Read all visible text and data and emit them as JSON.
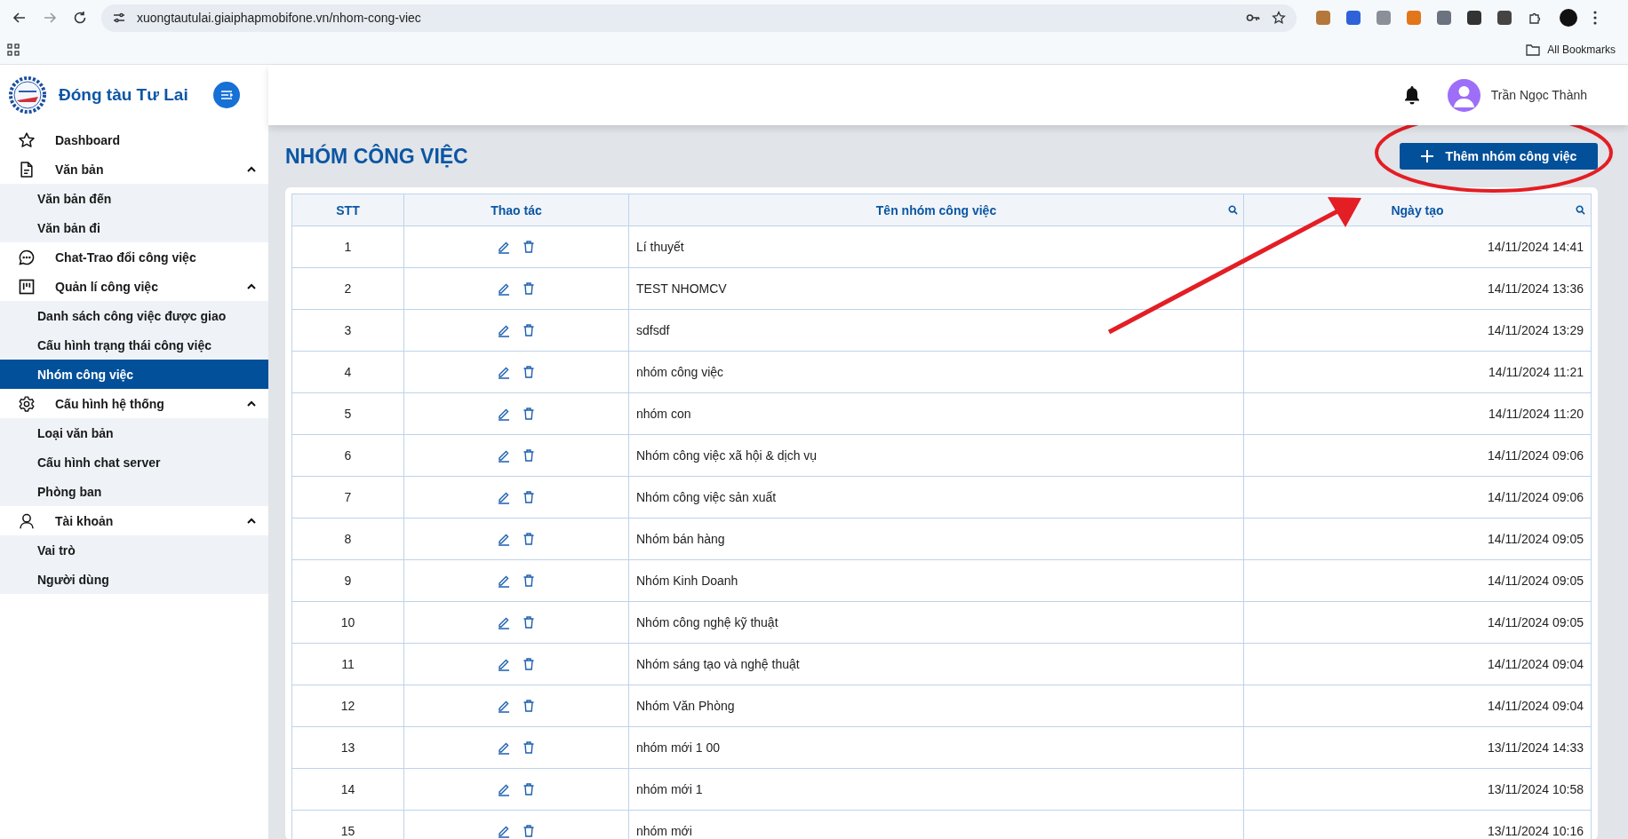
{
  "browser": {
    "url": "xuongtautulai.giaiphapmobifone.vn/nhom-cong-viec",
    "bookmarks_label": "All Bookmarks"
  },
  "app": {
    "name": "Đóng tàu Tư Lai"
  },
  "user": {
    "name": "Trần Ngọc Thành"
  },
  "sidebar": {
    "items": [
      {
        "label": "Dashboard",
        "selected": false
      },
      {
        "label": "Văn bản",
        "selected": false,
        "expanded": true,
        "children": [
          {
            "label": "Văn bản đến",
            "selected": false
          },
          {
            "label": "Văn bản đi",
            "selected": false
          }
        ]
      },
      {
        "label": "Chat-Trao đổi công việc",
        "selected": false
      },
      {
        "label": "Quản lí công việc",
        "selected": false,
        "expanded": true,
        "children": [
          {
            "label": "Danh sách công việc được giao",
            "selected": false
          },
          {
            "label": "Cấu hình trạng thái công việc",
            "selected": false
          },
          {
            "label": "Nhóm công việc",
            "selected": true
          }
        ]
      },
      {
        "label": "Cấu hình hệ thống",
        "selected": false,
        "expanded": true,
        "children": [
          {
            "label": "Loại văn bản",
            "selected": false
          },
          {
            "label": "Cấu hình chat server",
            "selected": false
          },
          {
            "label": "Phòng ban",
            "selected": false
          }
        ]
      },
      {
        "label": "Tài khoản",
        "selected": false,
        "expanded": true,
        "children": [
          {
            "label": "Vai trò",
            "selected": false
          },
          {
            "label": "Người dùng",
            "selected": false
          }
        ]
      }
    ]
  },
  "page": {
    "title": "NHÓM CÔNG VIỆC",
    "add_button": "Thêm nhóm công việc"
  },
  "table": {
    "columns": [
      {
        "label": "STT",
        "searchable": false
      },
      {
        "label": "Thao tác",
        "searchable": false
      },
      {
        "label": "Tên nhóm công việc",
        "searchable": true
      },
      {
        "label": "Ngày tạo",
        "searchable": true
      }
    ],
    "rows": [
      {
        "stt": "1",
        "name": "Lí thuyết",
        "created": "14/11/2024 14:41"
      },
      {
        "stt": "2",
        "name": "TEST NHOMCV",
        "created": "14/11/2024 13:36"
      },
      {
        "stt": "3",
        "name": "sdfsdf",
        "created": "14/11/2024 13:29"
      },
      {
        "stt": "4",
        "name": "nhóm công việc",
        "created": "14/11/2024 11:21"
      },
      {
        "stt": "5",
        "name": "nhóm con",
        "created": "14/11/2024 11:20"
      },
      {
        "stt": "6",
        "name": "Nhóm công việc xã hội & dịch vụ",
        "created": "14/11/2024 09:06"
      },
      {
        "stt": "7",
        "name": "Nhóm công việc sản xuất",
        "created": "14/11/2024 09:06"
      },
      {
        "stt": "8",
        "name": "Nhóm bán hàng",
        "created": "14/11/2024 09:05"
      },
      {
        "stt": "9",
        "name": "Nhóm Kinh Doanh",
        "created": "14/11/2024 09:05"
      },
      {
        "stt": "10",
        "name": "Nhóm công nghệ kỹ thuật",
        "created": "14/11/2024 09:05"
      },
      {
        "stt": "11",
        "name": "Nhóm sáng tạo và nghệ thuật",
        "created": "14/11/2024 09:04"
      },
      {
        "stt": "12",
        "name": "Nhóm Văn Phòng",
        "created": "14/11/2024 09:04"
      },
      {
        "stt": "13",
        "name": "nhóm mới 1 00",
        "created": "13/11/2024 14:33"
      },
      {
        "stt": "14",
        "name": "nhóm mới 1",
        "created": "13/11/2024 10:58"
      },
      {
        "stt": "15",
        "name": "nhóm mới",
        "created": "13/11/2024 10:16"
      }
    ]
  }
}
